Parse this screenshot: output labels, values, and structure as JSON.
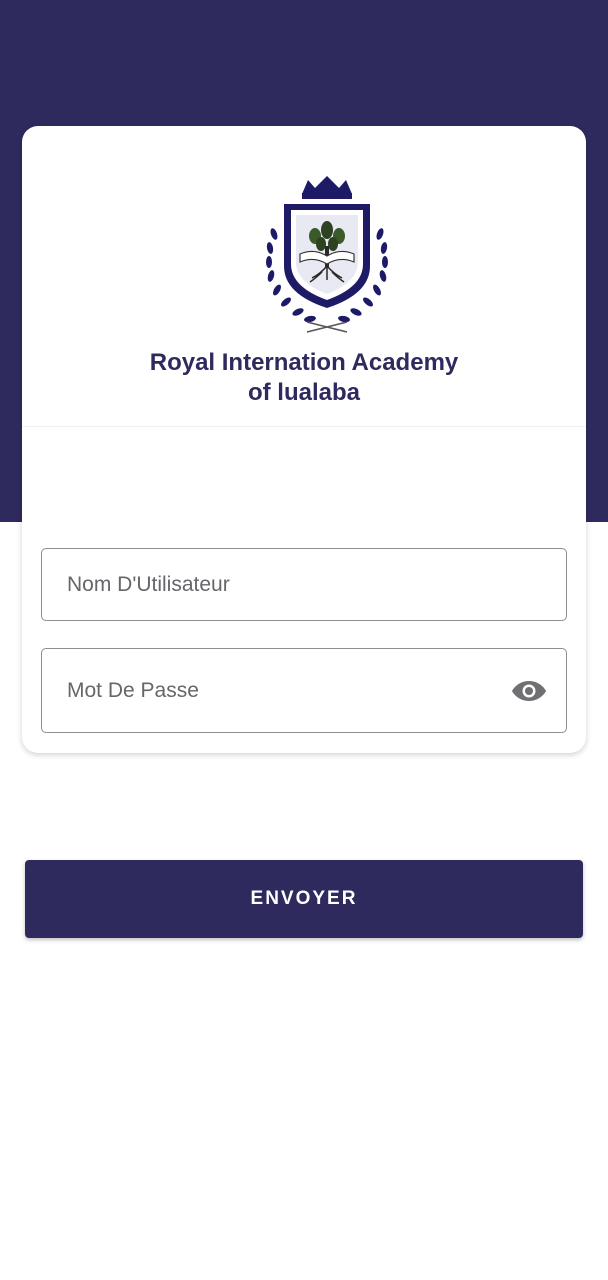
{
  "theme": {
    "primary": "#2e2a5e",
    "title_color": "#2e2a5e",
    "button_text": "#ffffff",
    "background": "#ffffff"
  },
  "header": {
    "school_name_line1": "Royal Internation Academy",
    "school_name_line2": "of lualaba",
    "logo_icon": "crest-logo-icon"
  },
  "form": {
    "username": {
      "placeholder": "Nom D'Utilisateur",
      "value": ""
    },
    "password": {
      "placeholder": "Mot De Passe",
      "value": "",
      "toggle_icon": "eye-icon"
    }
  },
  "submit": {
    "label": "ENVOYER"
  }
}
